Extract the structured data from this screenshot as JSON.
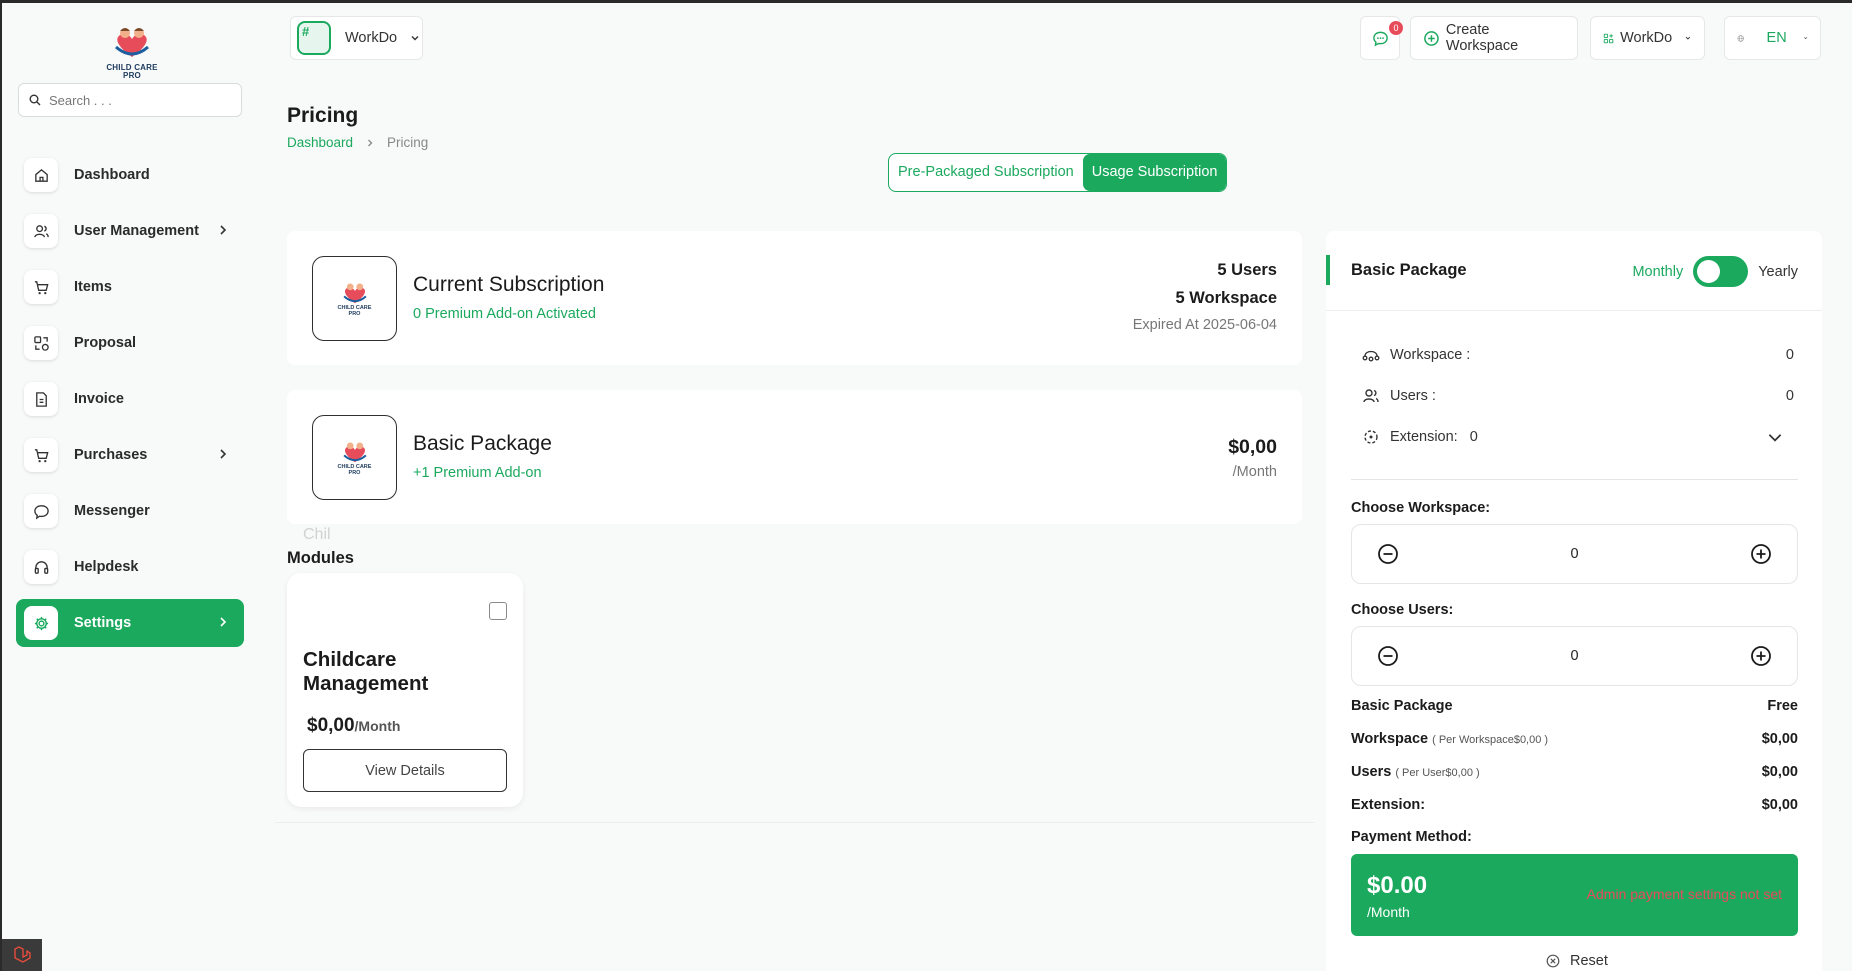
{
  "brand": {
    "logo_line1": "CHILD CARE",
    "logo_line2": "PRO"
  },
  "search": {
    "placeholder": "Search . . ."
  },
  "sidebar": {
    "items": [
      {
        "label": "Dashboard",
        "icon": "home-icon"
      },
      {
        "label": "User Management",
        "icon": "users-icon",
        "has_children": true
      },
      {
        "label": "Items",
        "icon": "cart-icon"
      },
      {
        "label": "Proposal",
        "icon": "proposal-icon"
      },
      {
        "label": "Invoice",
        "icon": "invoice-icon"
      },
      {
        "label": "Purchases",
        "icon": "cart-icon",
        "has_children": true
      },
      {
        "label": "Messenger",
        "icon": "chat-icon"
      },
      {
        "label": "Helpdesk",
        "icon": "headset-icon"
      },
      {
        "label": "Settings",
        "icon": "gear-icon",
        "has_children": true,
        "active": true
      }
    ]
  },
  "header": {
    "workspace_hash": "#",
    "workspace_name": "WorkDo",
    "messages_badge": "0",
    "create_workspace": "Create Workspace",
    "workspace_menu": "WorkDo",
    "language": "EN"
  },
  "page": {
    "title": "Pricing",
    "breadcrumb_home": "Dashboard",
    "breadcrumb_current": "Pricing"
  },
  "subscription_toggle": {
    "prepackaged": "Pre-Packaged Subscription",
    "usage": "Usage Subscription",
    "active": "usage"
  },
  "current_subscription": {
    "title": "Current Subscription",
    "addons": "0 Premium Add-on Activated",
    "users": "5 Users",
    "workspace": "5 Workspace",
    "expires": "Expired At 2025-06-04"
  },
  "basic_package": {
    "title": "Basic Package",
    "addons": "+1 Premium Add-on",
    "price": "$0,00",
    "period": "/Month"
  },
  "ghost_text": "Chil",
  "modules": {
    "title": "Modules",
    "items": [
      {
        "name": "Childcare Management",
        "price": "$0,00",
        "period": "/Month",
        "button": "View Details",
        "checked": false
      }
    ]
  },
  "panel": {
    "title": "Basic Package",
    "monthly": "Monthly",
    "yearly": "Yearly",
    "billing_yearly": true,
    "workspace_label": "Workspace :",
    "workspace_value": "0",
    "users_label": "Users :",
    "users_value": "0",
    "extension_label": "Extension:",
    "extension_value": "0",
    "choose_workspace": "Choose Workspace:",
    "workspace_count": "0",
    "choose_users": "Choose Users:",
    "users_count": "0",
    "summary": {
      "package_label": "Basic Package",
      "package_value": "Free",
      "workspace_label": "Workspace",
      "workspace_note": "( Per Workspace$0,00 )",
      "workspace_value": "$0,00",
      "users_label": "Users",
      "users_note": "( Per User$0,00 )",
      "users_value": "$0,00",
      "extension_label": "Extension:",
      "extension_value": "$0,00"
    },
    "payment_method": "Payment Method:",
    "total": "$0.00",
    "total_period": "/Month",
    "payment_warning": "Admin payment settings not set",
    "reset": "Reset"
  },
  "colors": {
    "accent": "#1ba95e",
    "danger": "#e74c5b",
    "background": "#f8f9f9"
  }
}
